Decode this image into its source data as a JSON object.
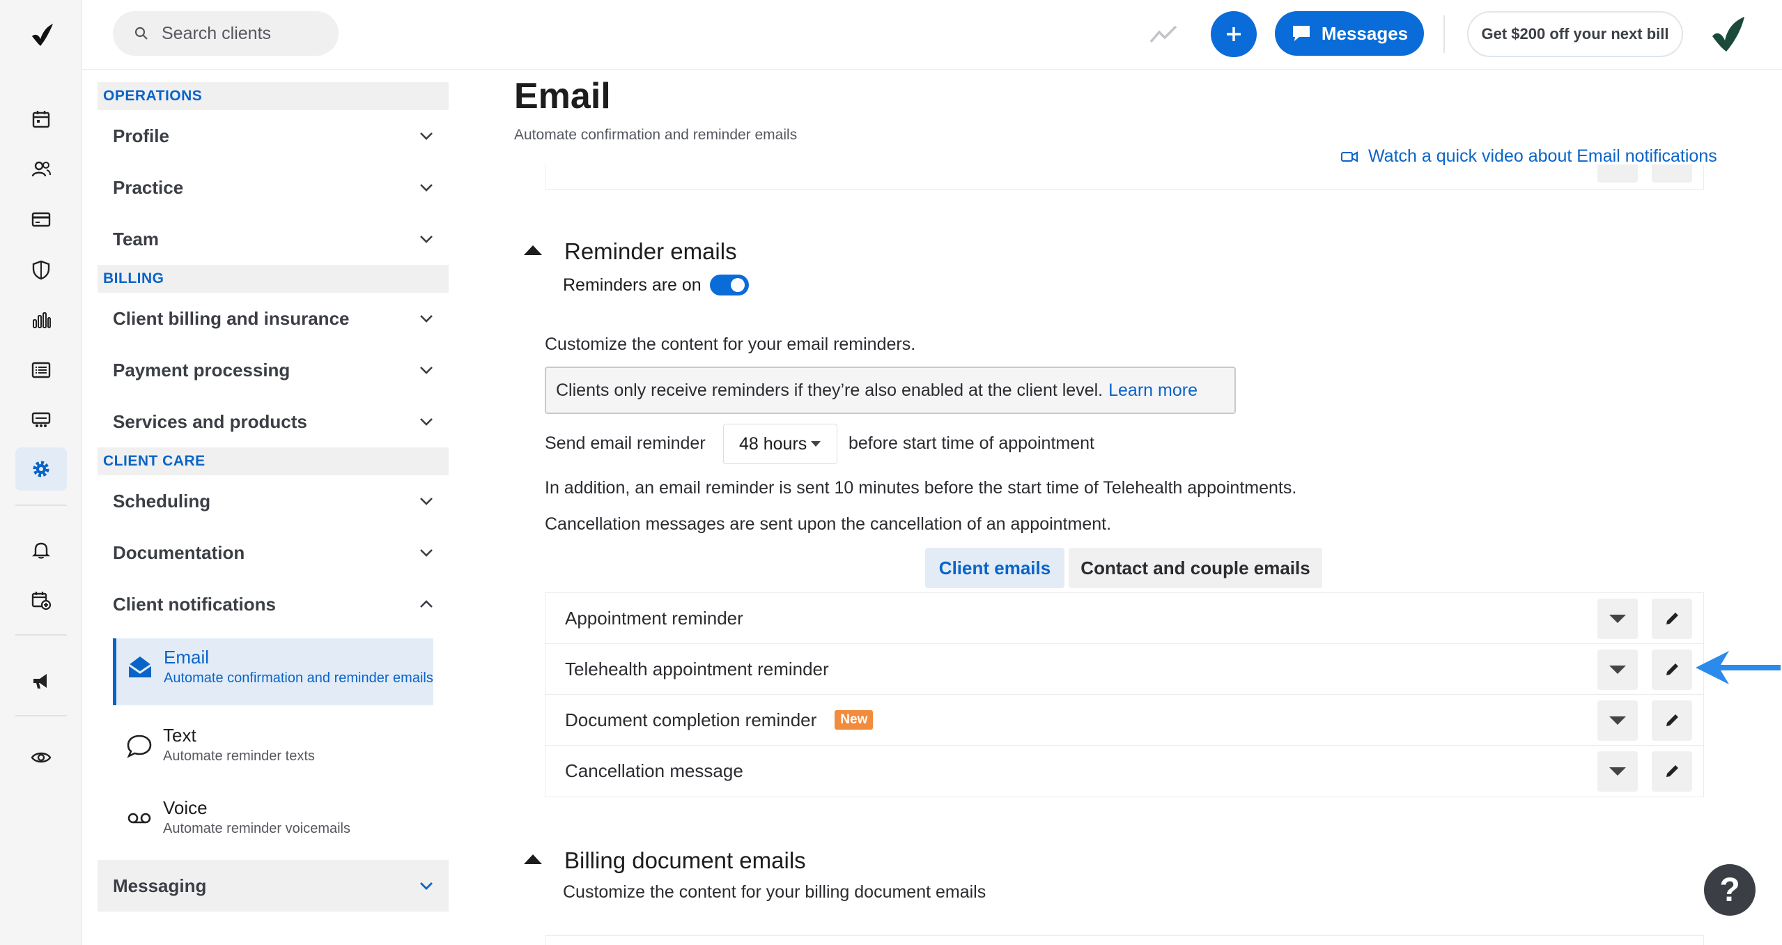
{
  "topbar": {
    "search_placeholder": "Search clients",
    "messages_label": "Messages",
    "promo_label": "Get $200 off your next bill"
  },
  "sidebar": {
    "sections": [
      {
        "heading": "OPERATIONS",
        "items": [
          "Profile",
          "Practice",
          "Team"
        ]
      },
      {
        "heading": "BILLING",
        "items": [
          "Client billing and insurance",
          "Payment processing",
          "Services and products"
        ]
      },
      {
        "heading": "CLIENT CARE",
        "items": [
          "Scheduling",
          "Documentation",
          "Client notifications"
        ]
      }
    ],
    "sub_items": [
      {
        "title": "Email",
        "desc": "Automate confirmation and reminder emails",
        "icon": "envelope-icon"
      },
      {
        "title": "Text",
        "desc": "Automate reminder texts",
        "icon": "chat-bubble-icon"
      },
      {
        "title": "Voice",
        "desc": "Automate reminder voicemails",
        "icon": "voicemail-icon"
      }
    ],
    "messaging_label": "Messaging"
  },
  "main": {
    "title": "Email",
    "subtitle": "Automate confirmation and reminder emails",
    "video_link": "Watch a quick video about Email notifications",
    "reminders": {
      "heading": "Reminder emails",
      "toggle_label": "Reminders are on",
      "customize_text": "Customize the content for your email reminders.",
      "info_text": "Clients only receive reminders if they’re also enabled at the client level.",
      "learn_more": "Learn more",
      "send_prefix": "Send email reminder",
      "send_value": "48 hours",
      "send_suffix": "before start time of appointment",
      "telehealth_note": "In addition, an email reminder is sent 10 minutes before the start time of Telehealth appointments.",
      "cancellation_note": "Cancellation messages are sent upon the cancellation of an appointment.",
      "tabs": [
        "Client emails",
        "Contact and couple emails"
      ],
      "rows": [
        {
          "label": "Appointment reminder",
          "badge": ""
        },
        {
          "label": "Telehealth appointment reminder",
          "badge": ""
        },
        {
          "label": "Document completion reminder",
          "badge": "New"
        },
        {
          "label": "Cancellation message",
          "badge": ""
        }
      ]
    },
    "billing": {
      "heading": "Billing document emails",
      "subtitle": "Customize the content for your billing document emails"
    }
  },
  "help_label": "?",
  "colors": {
    "accent": "#0a6cd8",
    "badge": "#f28b3c",
    "active_bg": "#e3ecf6"
  }
}
